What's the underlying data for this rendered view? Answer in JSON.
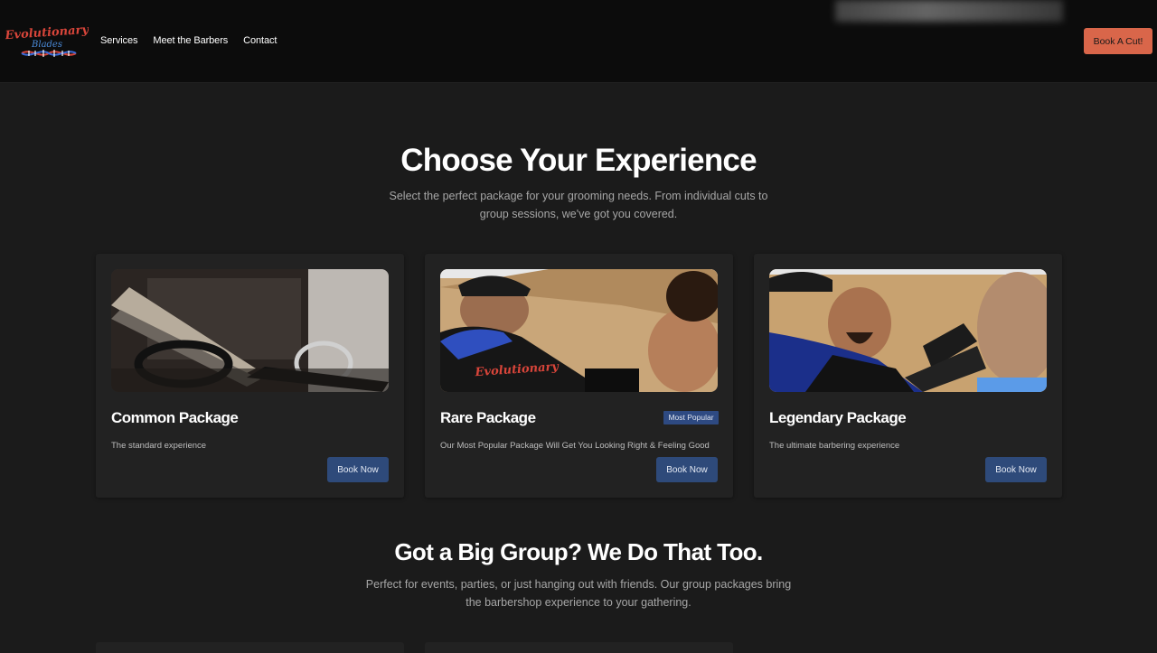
{
  "header": {
    "logo_text_line1": "Evolutionary",
    "logo_text_line2": "Blades",
    "nav": [
      {
        "label": "Services"
      },
      {
        "label": "Meet the Barbers"
      },
      {
        "label": "Contact"
      }
    ],
    "cta_label": "Book A Cut!"
  },
  "experience": {
    "title": "Choose Your Experience",
    "subtitle": "Select the perfect package for your grooming needs. From individual cuts to group sessions, we've got you covered.",
    "packages": [
      {
        "title": "Common Package",
        "description": "The standard experience",
        "button_label": "Book Now",
        "image_icon": "scissors-photo"
      },
      {
        "title": "Rare Package",
        "badge": "Most Popular",
        "description": "Our Most Popular Package Will Get You Looking Right & Feeling Good",
        "button_label": "Book Now",
        "image_icon": "barber-cutting-hair-photo"
      },
      {
        "title": "Legendary Package",
        "description": "The ultimate barbering experience",
        "button_label": "Book Now",
        "image_icon": "barber-trimming-photo"
      }
    ]
  },
  "group": {
    "title": "Got a Big Group? We Do That Too.",
    "subtitle": "Perfect for events, parties, or just hanging out with friends. Our group packages bring the barbershop experience to your gathering."
  },
  "colors": {
    "background": "#1b1b1b",
    "header": "#0c0c0c",
    "card": "#222222",
    "accent_cta": "#d9664a",
    "button_blue": "#2e4a7a"
  }
}
